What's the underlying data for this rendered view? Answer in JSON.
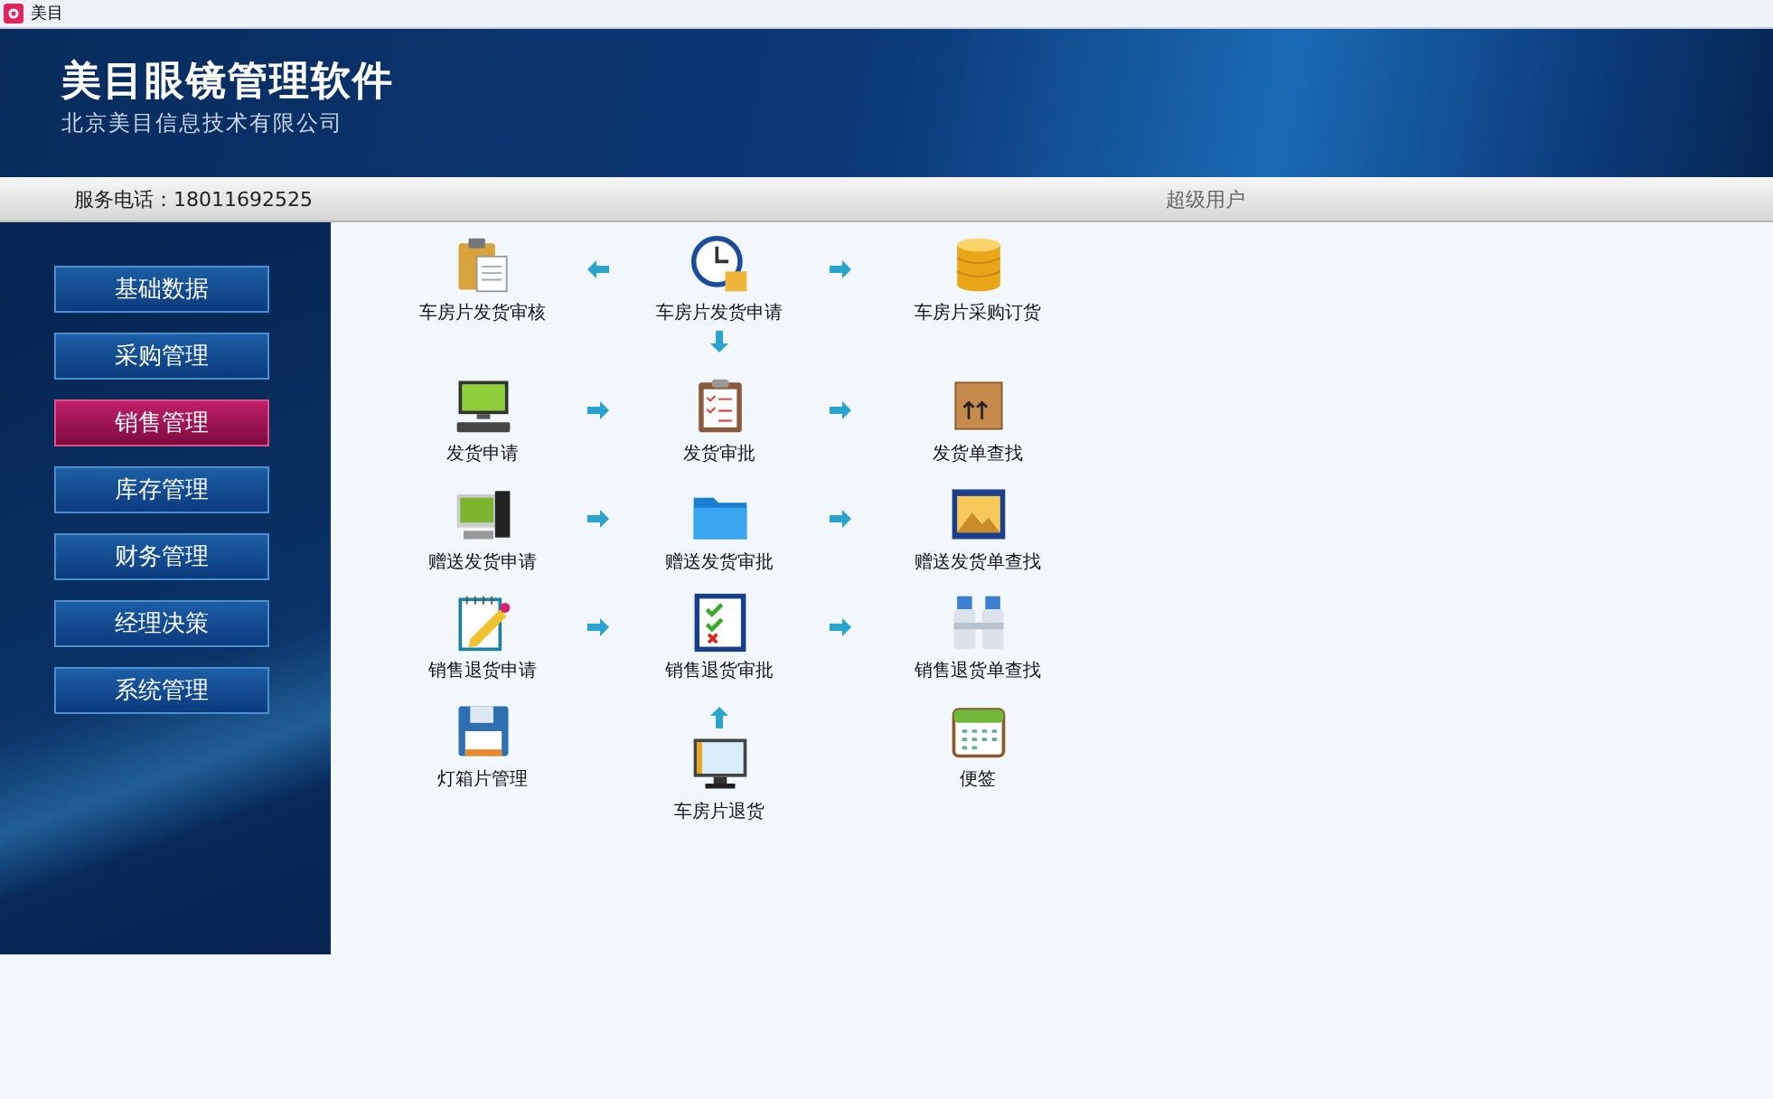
{
  "window": {
    "title": "美目"
  },
  "banner": {
    "title": "美目眼镜管理软件",
    "subtitle": "北京美目信息技术有限公司"
  },
  "info_bar": {
    "phone": "服务电话：18011692525",
    "user": "超级用户"
  },
  "sidebar": {
    "items": [
      {
        "label": "基础数据",
        "selected": false
      },
      {
        "label": "采购管理",
        "selected": false
      },
      {
        "label": "销售管理",
        "selected": true
      },
      {
        "label": "库存管理",
        "selected": false
      },
      {
        "label": "财务管理",
        "selected": false
      },
      {
        "label": "经理决策",
        "selected": false
      },
      {
        "label": "系统管理",
        "selected": false
      }
    ]
  },
  "grid": {
    "rows": [
      {
        "cells": [
          {
            "kind": "tile",
            "label": "车房片发货审核"
          },
          {
            "kind": "arrow_left"
          },
          {
            "kind": "tile",
            "label": "车房片发货申请",
            "connector_below": {
              "kind": "arrow_down"
            }
          },
          {
            "kind": "arrow_right"
          },
          {
            "kind": "tile",
            "label": "车房片采购订货"
          }
        ]
      },
      {
        "cells": [
          {
            "kind": "tile",
            "label": "发货申请"
          },
          {
            "kind": "arrow_right"
          },
          {
            "kind": "tile",
            "label": "发货审批"
          },
          {
            "kind": "arrow_right"
          },
          {
            "kind": "tile",
            "label": "发货单查找"
          }
        ]
      },
      {
        "cells": [
          {
            "kind": "tile",
            "label": "赠送发货申请"
          },
          {
            "kind": "arrow_right"
          },
          {
            "kind": "tile",
            "label": "赠送发货审批"
          },
          {
            "kind": "arrow_right"
          },
          {
            "kind": "tile",
            "label": "赠送发货单查找"
          }
        ]
      },
      {
        "cells": [
          {
            "kind": "tile",
            "label": "销售退货申请"
          },
          {
            "kind": "arrow_right"
          },
          {
            "kind": "tile",
            "label": "销售退货审批"
          },
          {
            "kind": "arrow_right"
          },
          {
            "kind": "tile",
            "label": "销售退货单查找"
          }
        ]
      },
      {
        "cells": [
          {
            "kind": "tile",
            "label": "灯箱片管理"
          },
          {
            "kind": "blank"
          },
          {
            "kind": "tile",
            "label": "车房片退货",
            "connector_above": {
              "kind": "arrow_up"
            }
          },
          {
            "kind": "blank"
          },
          {
            "kind": "tile",
            "label": "便签"
          }
        ]
      }
    ]
  }
}
